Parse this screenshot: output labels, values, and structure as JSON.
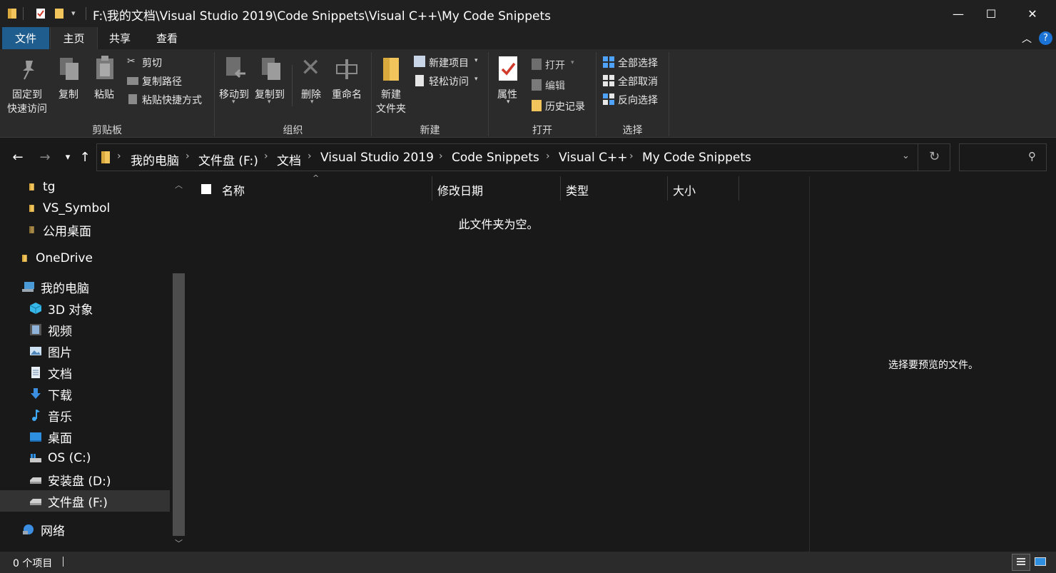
{
  "window": {
    "title": "F:\\我的文档\\Visual Studio 2019\\Code Snippets\\Visual C++\\My Code Snippets",
    "minimize": "—",
    "maximize": "☐",
    "close": "✕"
  },
  "tabs": {
    "file": "文件",
    "home": "主页",
    "share": "共享",
    "view": "查看"
  },
  "ribbon": {
    "clipboard": {
      "group": "剪贴板",
      "pin_line1": "固定到",
      "pin_line2": "快速访问",
      "copy": "复制",
      "paste": "粘贴",
      "cut": "剪切",
      "copy_path": "复制路径",
      "paste_shortcut": "粘贴快捷方式"
    },
    "organize": {
      "group": "组织",
      "move_to": "移动到",
      "copy_to": "复制到",
      "delete": "删除",
      "rename": "重命名"
    },
    "new": {
      "group": "新建",
      "new_folder_line1": "新建",
      "new_folder_line2": "文件夹",
      "new_item": "新建项目",
      "easy_access": "轻松访问"
    },
    "open": {
      "group": "打开",
      "properties": "属性",
      "open": "打开",
      "edit": "编辑",
      "history": "历史记录"
    },
    "select": {
      "group": "选择",
      "select_all": "全部选择",
      "select_none": "全部取消",
      "invert": "反向选择"
    }
  },
  "breadcrumb": [
    "我的电脑",
    "文件盘 (F:)",
    "文档",
    "Visual Studio 2019",
    "Code Snippets",
    "Visual C++",
    "My Code Snippets"
  ],
  "sidebar": {
    "items": [
      {
        "label": "tg",
        "icon": "folder-icon"
      },
      {
        "label": "VS_Symbol",
        "icon": "folder-icon"
      },
      {
        "label": "公用桌面",
        "icon": "folder-icon"
      },
      {
        "label": "OneDrive",
        "icon": "folder-icon"
      },
      {
        "label": "我的电脑",
        "icon": "computer-icon"
      },
      {
        "label": "3D 对象",
        "icon": "cube-icon"
      },
      {
        "label": "视频",
        "icon": "video-icon"
      },
      {
        "label": "图片",
        "icon": "pictures-icon"
      },
      {
        "label": "文档",
        "icon": "document-icon"
      },
      {
        "label": "下载",
        "icon": "download-icon"
      },
      {
        "label": "音乐",
        "icon": "music-icon"
      },
      {
        "label": "桌面",
        "icon": "desktop-icon"
      },
      {
        "label": "OS (C:)",
        "icon": "os-drive-icon"
      },
      {
        "label": "安装盘 (D:)",
        "icon": "drive-icon"
      },
      {
        "label": "文件盘 (F:)",
        "icon": "drive-icon"
      },
      {
        "label": "网络",
        "icon": "network-icon"
      }
    ]
  },
  "columns": {
    "name": "名称",
    "modified": "修改日期",
    "type": "类型",
    "size": "大小"
  },
  "content": {
    "empty_message": "此文件夹为空。"
  },
  "preview": {
    "message": "选择要预览的文件。"
  },
  "status": {
    "item_count": "0 个项目"
  },
  "colors": {
    "file_tab": "#1f5d8f",
    "background": "#191919",
    "ribbon": "#2b2b2b",
    "folder": "#f2c55c"
  }
}
